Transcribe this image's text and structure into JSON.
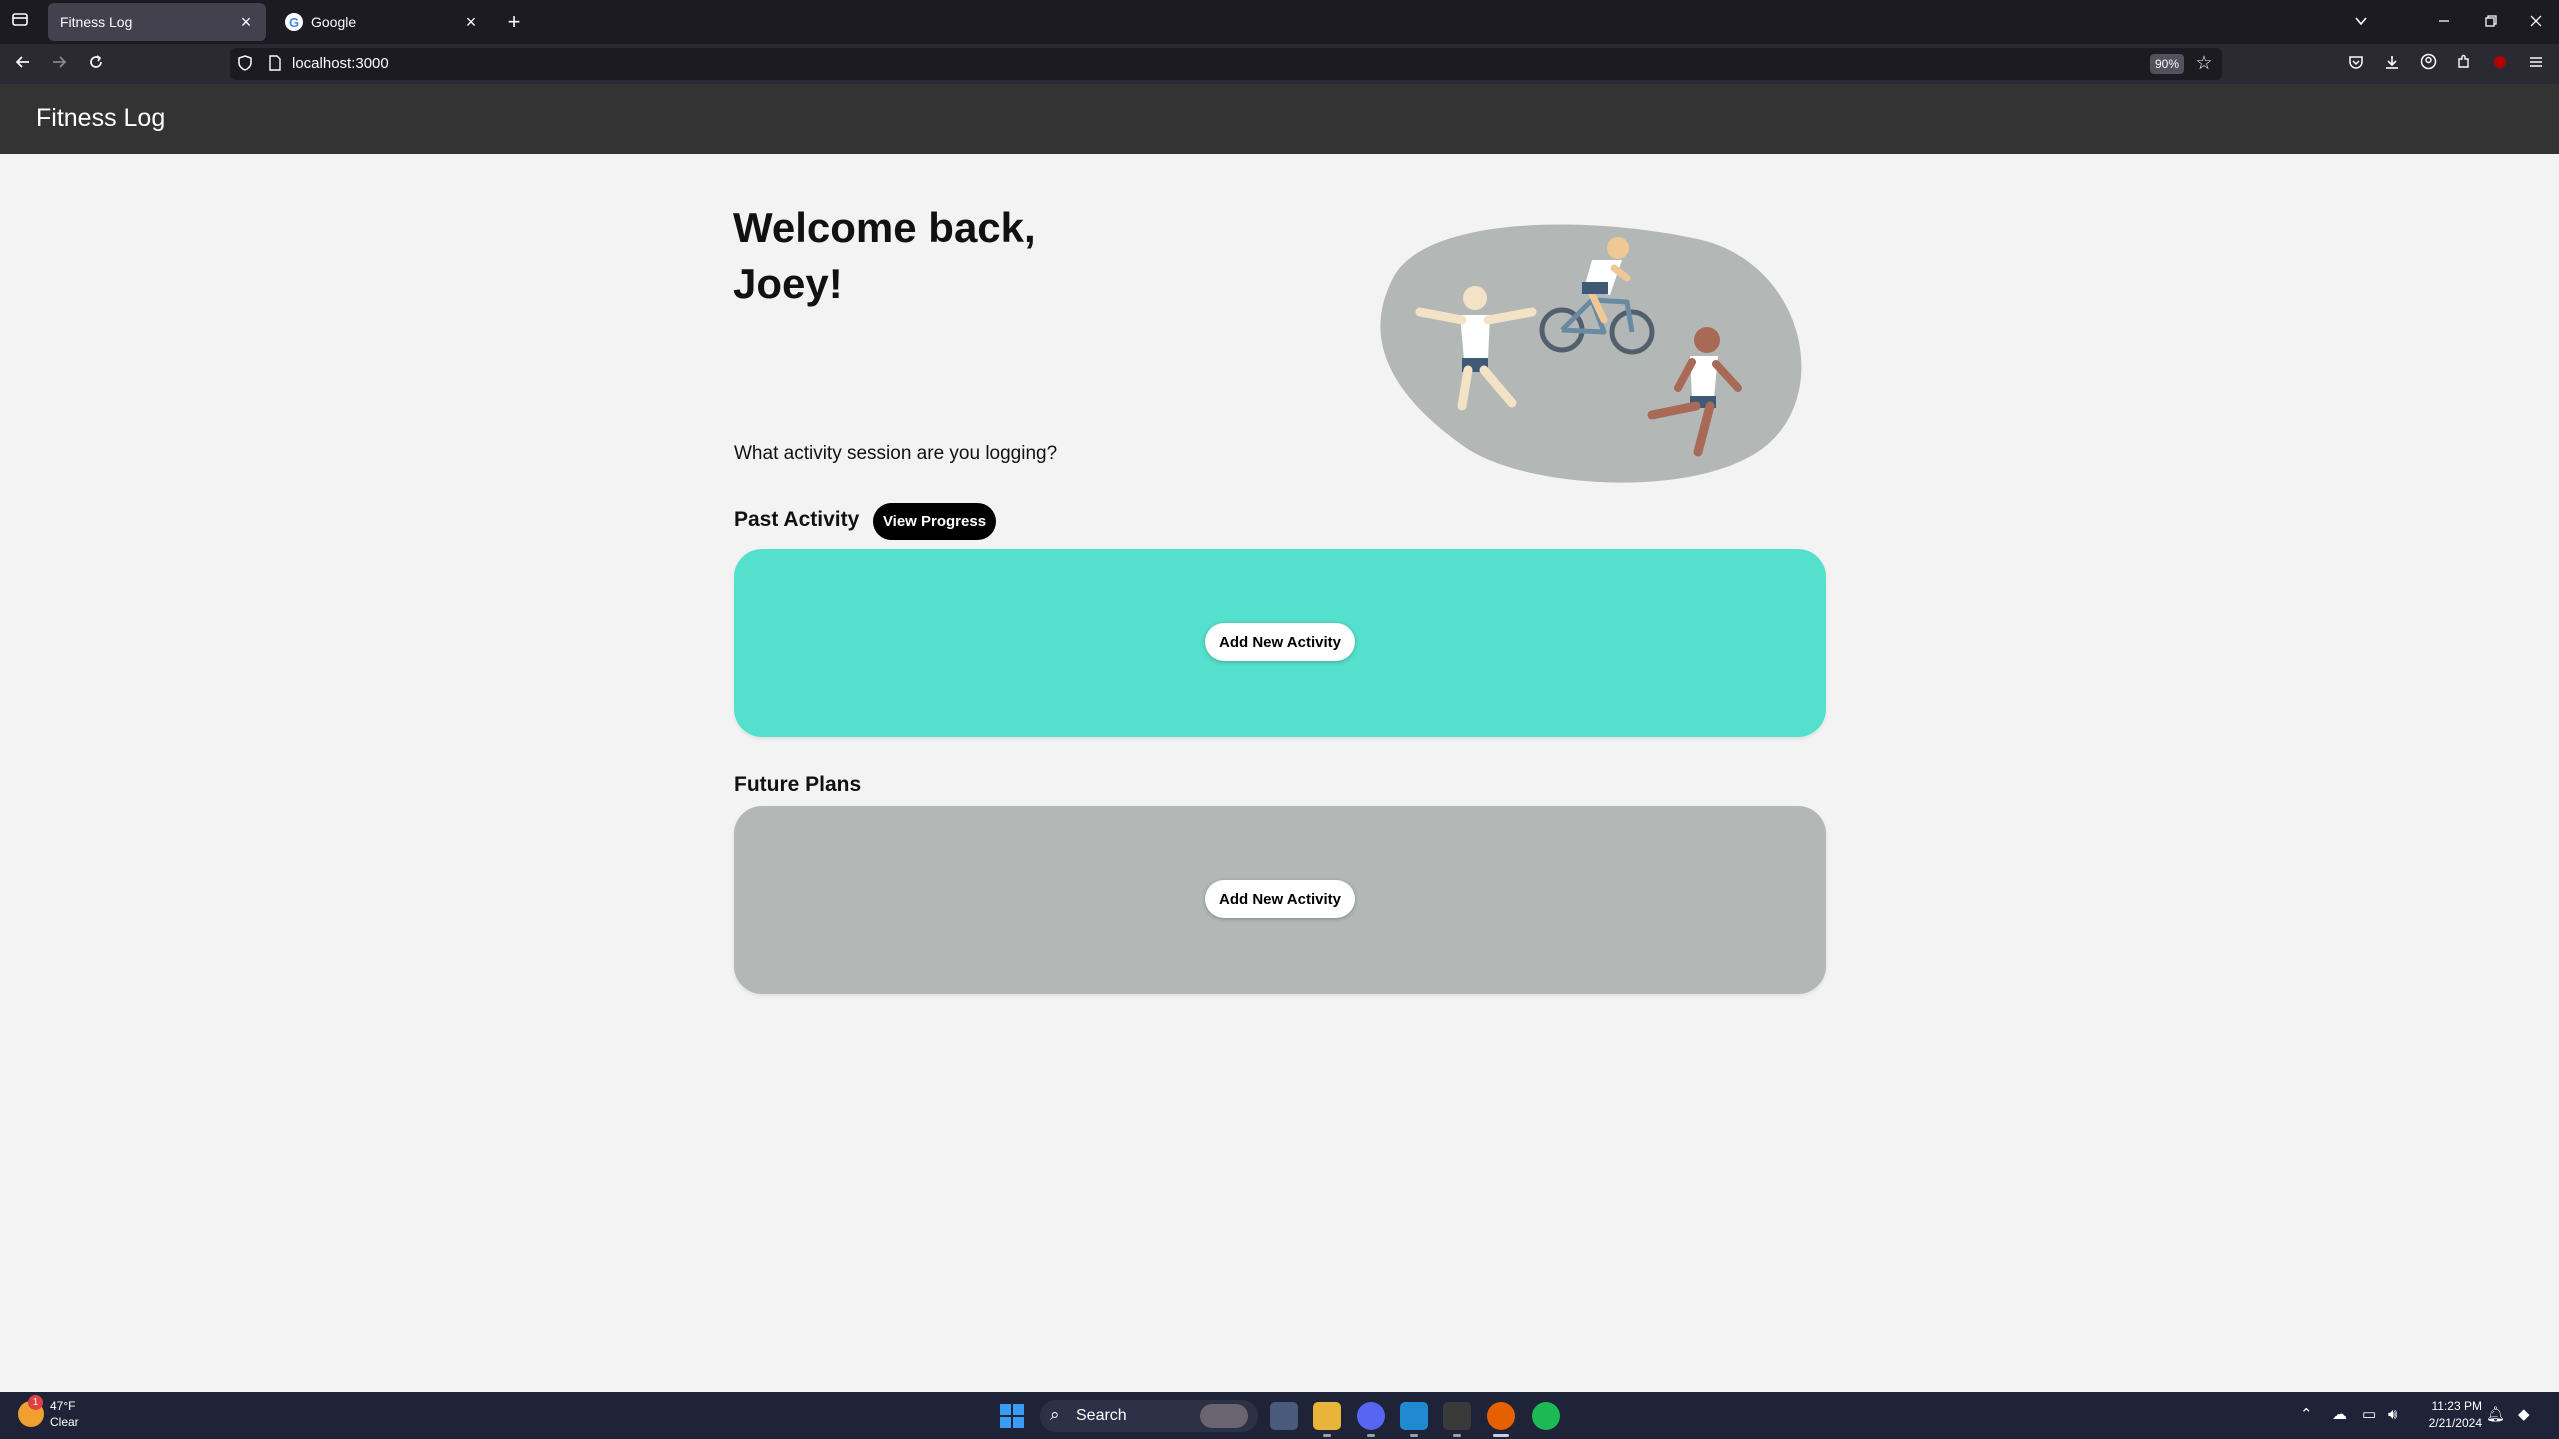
{
  "browser": {
    "tabs": [
      {
        "label": "Fitness Log",
        "active": true
      },
      {
        "label": "Google",
        "active": false,
        "favicon_letter": "G"
      }
    ],
    "url": "localhost:3000",
    "zoom": "90%",
    "icons": [
      "tab-list-icon",
      "close-icon",
      "plus-icon",
      "chevron-down-icon",
      "minimize-icon",
      "restore-icon",
      "back-icon",
      "forward-icon",
      "reload-icon",
      "shield-icon",
      "page-icon",
      "star-icon",
      "pocket-icon",
      "download-icon",
      "account-icon",
      "extensions-icon",
      "ublock-icon",
      "menu-icon"
    ]
  },
  "app": {
    "title": "Fitness Log",
    "welcome": "Welcome back, Joey!",
    "prompt": "What activity session are you logging?",
    "past_activity": {
      "title": "Past Activity",
      "view_progress": "View Progress",
      "add_label": "Add New Activity"
    },
    "future_plans": {
      "title": "Future Plans",
      "add_label": "Add New Activity"
    },
    "colors": {
      "header": "#333333",
      "past_card": "#54e0cc",
      "future_card": "#b3b8b7",
      "background": "#f3f3f3"
    }
  },
  "taskbar": {
    "weather_temp": "47°F",
    "weather_desc": "Clear",
    "weather_badge": "1",
    "search_label": "Search",
    "time": "11:23 PM",
    "date": "2/21/2024"
  }
}
